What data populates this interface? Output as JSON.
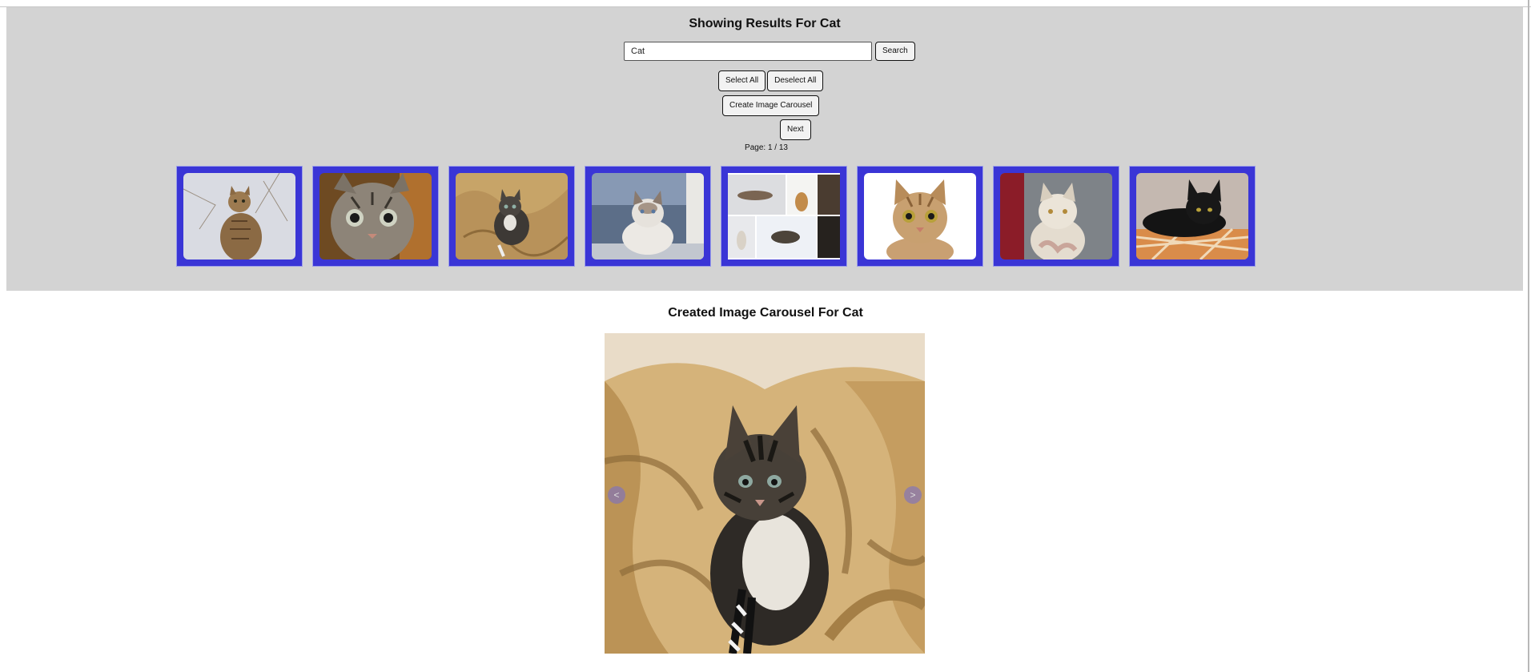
{
  "search_panel": {
    "title": "Showing Results For Cat",
    "search_value": "Cat",
    "search_button": "Search",
    "select_all_button": "Select All",
    "deselect_all_button": "Deselect All",
    "create_carousel_button": "Create Image Carousel",
    "next_button": "Next",
    "page_info": "Page: 1 / 13",
    "thumbnails": [
      {
        "name": "tabby cat sitting"
      },
      {
        "name": "tabby kitten closeup"
      },
      {
        "name": "kitten on blanket"
      },
      {
        "name": "ragdoll cat"
      },
      {
        "name": "cat collage"
      },
      {
        "name": "cat on white background"
      },
      {
        "name": "white cat"
      },
      {
        "name": "black cat"
      }
    ]
  },
  "carousel": {
    "title": "Created Image Carousel For Cat",
    "prev_label": "<",
    "next_label": ">"
  },
  "colors": {
    "panel_bg": "#d3d3d3",
    "thumb_border": "#3a35d6"
  }
}
